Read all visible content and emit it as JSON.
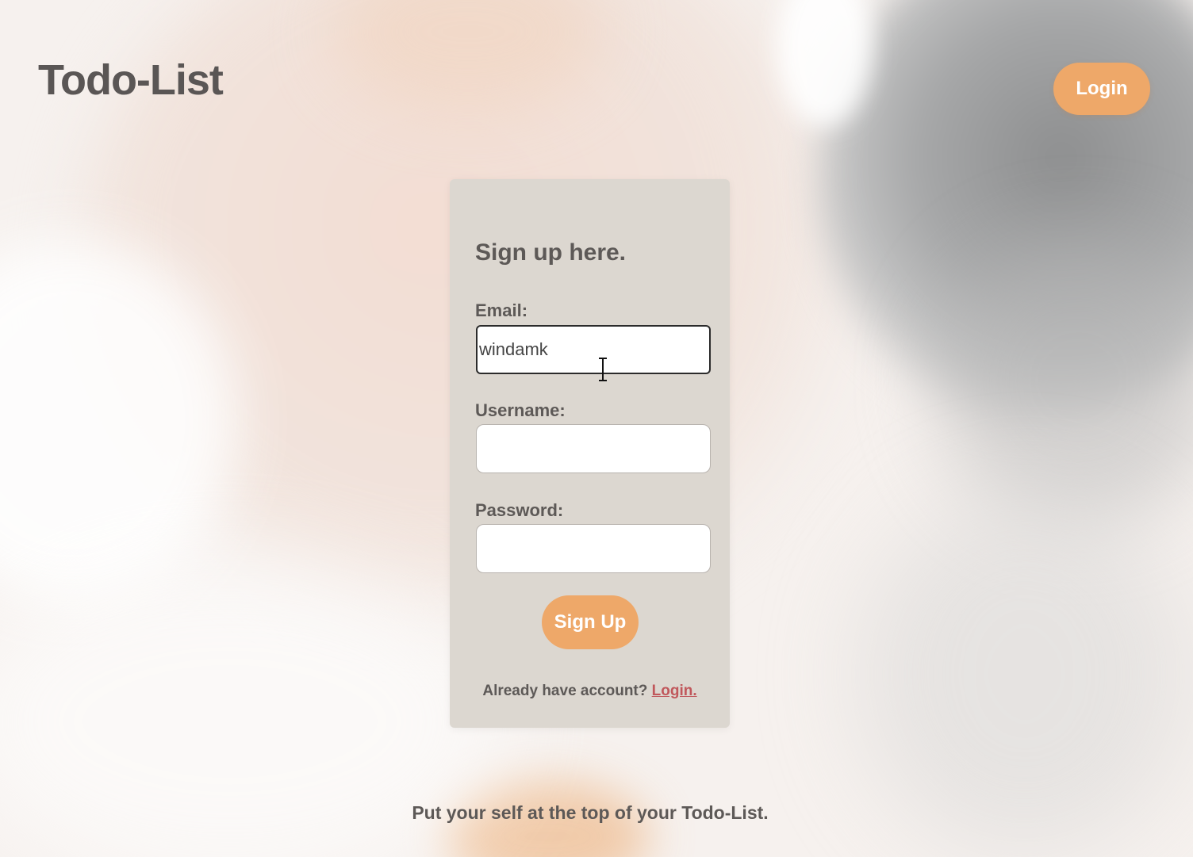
{
  "header": {
    "brand": "Todo-List",
    "login_label": "Login"
  },
  "signup_form": {
    "title": "Sign up here.",
    "email_label": "Email:",
    "email_value": "windamk",
    "username_label": "Username:",
    "username_value": "",
    "password_label": "Password:",
    "password_value": "",
    "submit_label": "Sign Up",
    "have_account_text": "Already have account?",
    "login_link_label": "Login."
  },
  "footer": {
    "tagline": "Put your self at the top of your Todo-List."
  },
  "colors": {
    "accent": "#eea869",
    "card": "#dcd7d0",
    "text": "#5d5957",
    "link": "#c0575b"
  },
  "icons": {
    "cursor": "text-cursor-icon"
  }
}
